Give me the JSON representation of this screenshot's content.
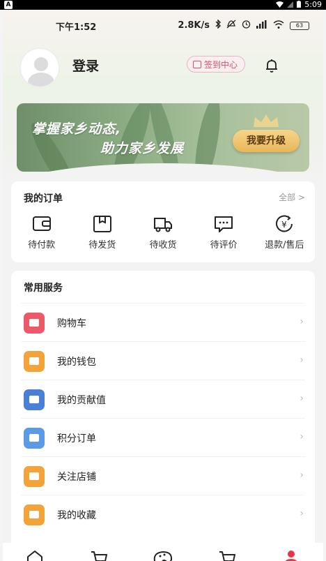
{
  "system_bar": {
    "time": "5:09"
  },
  "status_bar": {
    "time": "下午1:52",
    "speed": "2.8K/s",
    "battery": "63"
  },
  "profile": {
    "login_label": "登录",
    "signin_label": "签到中心"
  },
  "banner": {
    "line1": "掌握家乡动态,",
    "line2": "助力家乡发展",
    "upgrade_label": "我要升级"
  },
  "orders": {
    "title": "我的订单",
    "all_label": "全部 >",
    "items": [
      {
        "label": "待付款",
        "icon": "wallet-icon"
      },
      {
        "label": "待发货",
        "icon": "package-icon"
      },
      {
        "label": "待收货",
        "icon": "truck-icon"
      },
      {
        "label": "待评价",
        "icon": "comment-icon"
      },
      {
        "label": "退款/售后",
        "icon": "refund-icon"
      }
    ]
  },
  "services": {
    "title": "常用服务",
    "items": [
      {
        "label": "购物车",
        "icon": "cart-icon",
        "color": "#ec5a6a"
      },
      {
        "label": "我的钱包",
        "icon": "wallet-icon",
        "color": "#f3a33a"
      },
      {
        "label": "我的贡献值",
        "icon": "contribution-icon",
        "color": "#4a7fd6"
      },
      {
        "label": "积分订单",
        "icon": "points-order-icon",
        "color": "#5a9ae6"
      },
      {
        "label": "关注店铺",
        "icon": "store-icon",
        "color": "#f3a33a"
      },
      {
        "label": "我的收藏",
        "icon": "star-icon",
        "color": "#f3a33a"
      }
    ]
  },
  "bottom_nav": [
    {
      "icon": "home-icon"
    },
    {
      "icon": "cart-icon"
    },
    {
      "icon": "palette-icon"
    },
    {
      "icon": "cart-icon"
    },
    {
      "icon": "profile-icon",
      "active": true
    }
  ],
  "colors": {
    "accent": "#e8334a",
    "signin": "#d4506a",
    "upgrade": "#e9b65a"
  }
}
